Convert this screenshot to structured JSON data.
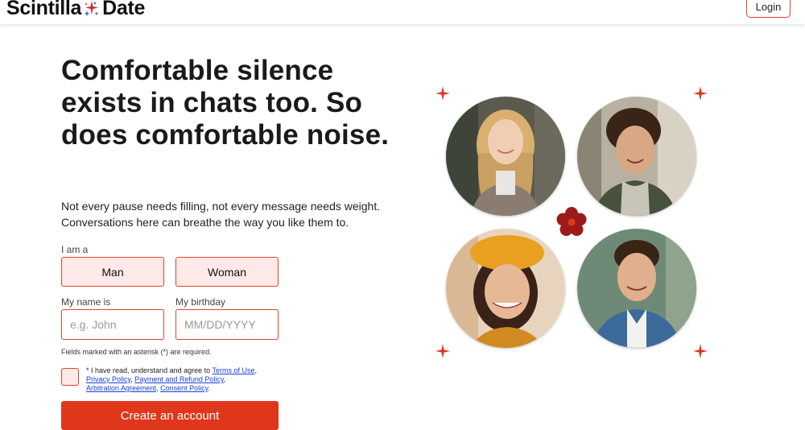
{
  "header": {
    "logo_left": "Scintilla",
    "logo_right": "Date",
    "login_label": "Login"
  },
  "hero": {
    "headline": "Comfortable silence exists in chats too. So does comfortable noise.",
    "subtext": "Not every pause needs filling, not every message needs weight. Conversations here can breathe the way you like them to."
  },
  "form": {
    "gender_label": "I am a",
    "gender_options": [
      "Man",
      "Woman"
    ],
    "name_label": "My name is",
    "name_placeholder": "e.g. John",
    "birthday_label": "My birthday",
    "birthday_placeholder": "MM/DD/YYYY",
    "required_note": "Fields marked with an asterisk (*) are required.",
    "consent_prefix": "* I have read, understand and agree to ",
    "consent_links": {
      "terms": "Terms of Use",
      "privacy": "Privacy Policy",
      "payment": "Payment and Refund Policy",
      "arbitration": "Arbitration Agreement",
      "consent": "Consent Policy"
    },
    "submit_label": "Create an account"
  },
  "colors": {
    "accent": "#e0361c",
    "accent_border": "#e0442a",
    "accent_light": "#fde9e7",
    "link": "#1a3fd6"
  },
  "icons": {
    "logo_mark": "sparkle-burst-icon",
    "corner_decor": "four-point-star-icon",
    "center_decor": "flower-icon"
  }
}
